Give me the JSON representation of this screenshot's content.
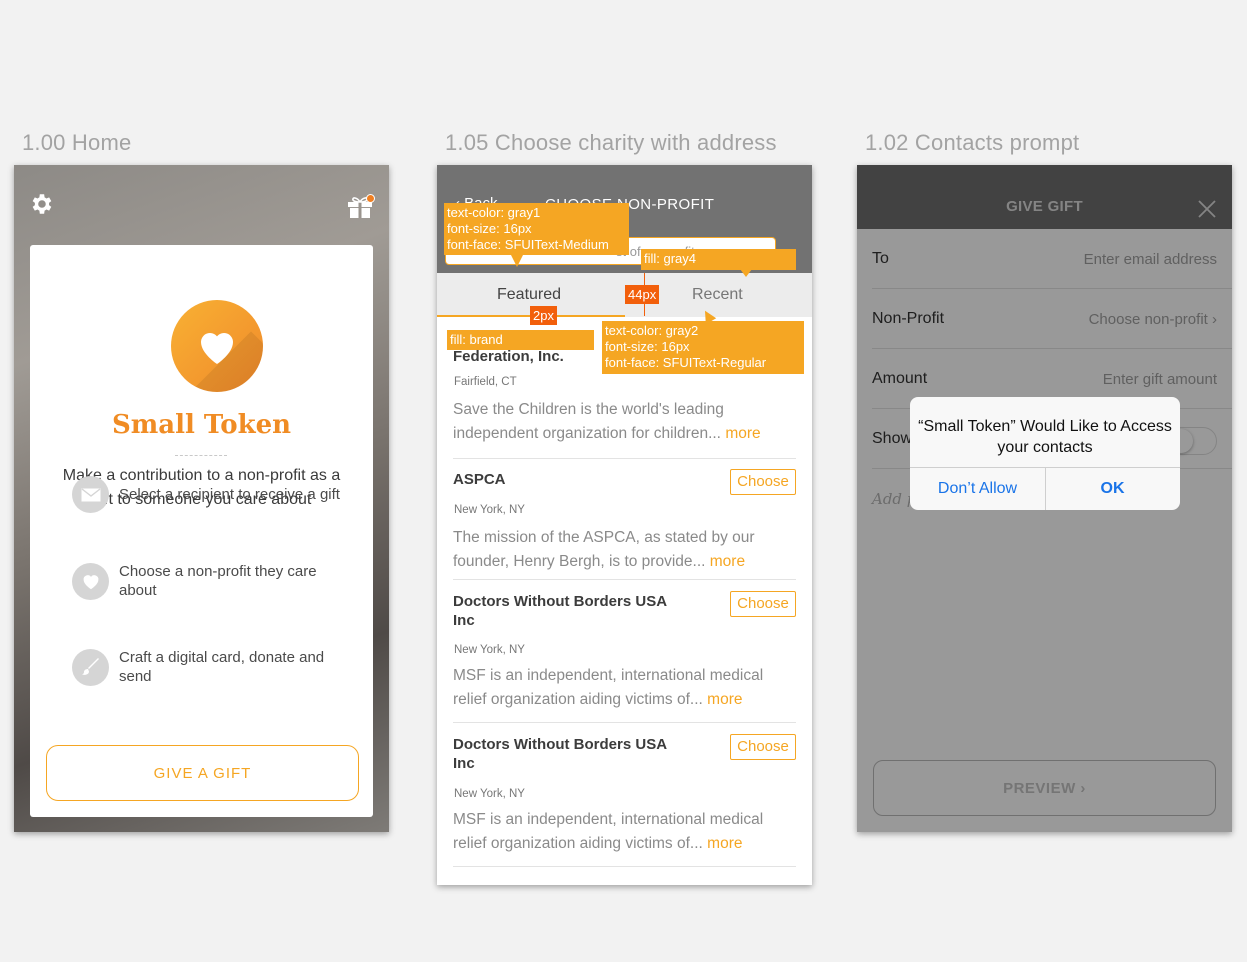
{
  "screens": {
    "home": {
      "label": "1.00 Home",
      "brand": "Small Token",
      "tagline": "Make a contribution to a non-profit as a gift to someone you care about",
      "steps": [
        {
          "icon": "envelope-icon",
          "text": "Select a recipient to receive a gift"
        },
        {
          "icon": "heart-icon",
          "text": "Choose a non-profit they care about"
        },
        {
          "icon": "brush-icon",
          "text": "Craft a digital card, donate and send"
        }
      ],
      "cta": "GIVE A GIFT"
    },
    "choose": {
      "label": "1.05 Choose charity with address",
      "back_label": "Back",
      "title": "CHOOSE NON-PROFIT",
      "search_placeholder": "st of nonprofits",
      "tabs": {
        "featured": "Featured",
        "recent": "Recent"
      },
      "charities": [
        {
          "name": "Federation, Inc.",
          "location": "Fairfield, CT",
          "description": "Save the Children is the world's leading independent organization for children...",
          "more": "more"
        },
        {
          "name": "ASPCA",
          "location": "New York, NY",
          "description": "The mission of the ASPCA, as stated by our founder, Henry Bergh, is to provide...",
          "more": "more",
          "action": "Choose"
        },
        {
          "name": "Doctors Without Borders USA Inc",
          "location": "New York, NY",
          "description": "MSF is an independent, international medical relief organization aiding victims of...",
          "more": "more",
          "action": "Choose"
        },
        {
          "name": "Doctors Without Borders USA Inc",
          "location": "New York, NY",
          "description": "MSF is an independent, international medical relief organization aiding victims of...",
          "more": "more",
          "action": "Choose"
        }
      ],
      "annotations": {
        "tab_spec": "text-color: gray1\nfont-size: 16px\nfont-face: SFUIText-Medium",
        "fill_gray4": "fill: gray4",
        "height_44": "44px",
        "height_2": "2px",
        "fill_brand": "fill: brand",
        "recent_spec": "text-color: gray2\nfont-size: 16px\nfont-face: SFUIText-Regular"
      }
    },
    "contacts": {
      "label": "1.02 Contacts prompt",
      "title": "GIVE GIFT",
      "rows": [
        {
          "label": "To",
          "value": "Enter email address"
        },
        {
          "label": "Non-Profit",
          "value": "Choose non-profit"
        },
        {
          "label": "Amount",
          "value": "Enter gift amount"
        },
        {
          "label": "Show amount",
          "value": ""
        }
      ],
      "note_placeholder": "Add p",
      "preview": "PREVIEW",
      "alert": {
        "message": "“Small Token” Would Like to Access your contacts",
        "deny": "Don’t Allow",
        "ok": "OK"
      }
    }
  },
  "colors": {
    "brand": "#f5a623",
    "brand_dark": "#f08c24",
    "annotation_red": "#f25f0b",
    "ios_blue": "#1a74e8"
  }
}
